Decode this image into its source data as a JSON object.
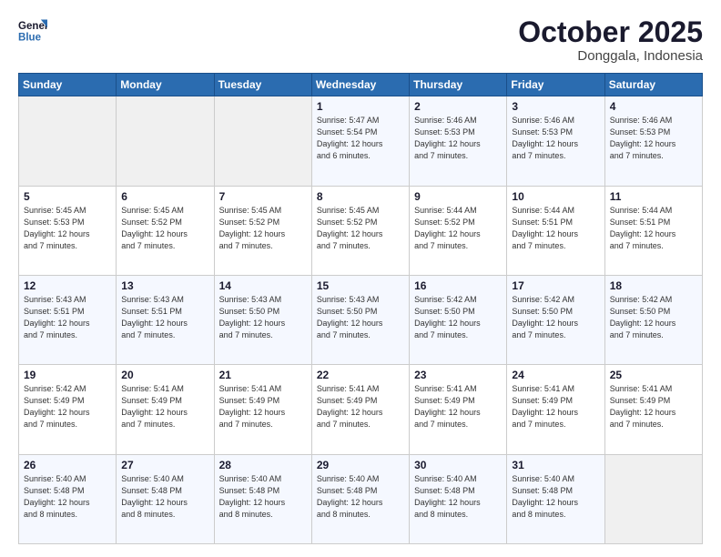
{
  "header": {
    "logo_line1": "General",
    "logo_line2": "Blue",
    "month": "October 2025",
    "location": "Donggala, Indonesia"
  },
  "weekdays": [
    "Sunday",
    "Monday",
    "Tuesday",
    "Wednesday",
    "Thursday",
    "Friday",
    "Saturday"
  ],
  "weeks": [
    [
      {
        "day": "",
        "info": ""
      },
      {
        "day": "",
        "info": ""
      },
      {
        "day": "",
        "info": ""
      },
      {
        "day": "1",
        "info": "Sunrise: 5:47 AM\nSunset: 5:54 PM\nDaylight: 12 hours\nand 6 minutes."
      },
      {
        "day": "2",
        "info": "Sunrise: 5:46 AM\nSunset: 5:53 PM\nDaylight: 12 hours\nand 7 minutes."
      },
      {
        "day": "3",
        "info": "Sunrise: 5:46 AM\nSunset: 5:53 PM\nDaylight: 12 hours\nand 7 minutes."
      },
      {
        "day": "4",
        "info": "Sunrise: 5:46 AM\nSunset: 5:53 PM\nDaylight: 12 hours\nand 7 minutes."
      }
    ],
    [
      {
        "day": "5",
        "info": "Sunrise: 5:45 AM\nSunset: 5:53 PM\nDaylight: 12 hours\nand 7 minutes."
      },
      {
        "day": "6",
        "info": "Sunrise: 5:45 AM\nSunset: 5:52 PM\nDaylight: 12 hours\nand 7 minutes."
      },
      {
        "day": "7",
        "info": "Sunrise: 5:45 AM\nSunset: 5:52 PM\nDaylight: 12 hours\nand 7 minutes."
      },
      {
        "day": "8",
        "info": "Sunrise: 5:45 AM\nSunset: 5:52 PM\nDaylight: 12 hours\nand 7 minutes."
      },
      {
        "day": "9",
        "info": "Sunrise: 5:44 AM\nSunset: 5:52 PM\nDaylight: 12 hours\nand 7 minutes."
      },
      {
        "day": "10",
        "info": "Sunrise: 5:44 AM\nSunset: 5:51 PM\nDaylight: 12 hours\nand 7 minutes."
      },
      {
        "day": "11",
        "info": "Sunrise: 5:44 AM\nSunset: 5:51 PM\nDaylight: 12 hours\nand 7 minutes."
      }
    ],
    [
      {
        "day": "12",
        "info": "Sunrise: 5:43 AM\nSunset: 5:51 PM\nDaylight: 12 hours\nand 7 minutes."
      },
      {
        "day": "13",
        "info": "Sunrise: 5:43 AM\nSunset: 5:51 PM\nDaylight: 12 hours\nand 7 minutes."
      },
      {
        "day": "14",
        "info": "Sunrise: 5:43 AM\nSunset: 5:50 PM\nDaylight: 12 hours\nand 7 minutes."
      },
      {
        "day": "15",
        "info": "Sunrise: 5:43 AM\nSunset: 5:50 PM\nDaylight: 12 hours\nand 7 minutes."
      },
      {
        "day": "16",
        "info": "Sunrise: 5:42 AM\nSunset: 5:50 PM\nDaylight: 12 hours\nand 7 minutes."
      },
      {
        "day": "17",
        "info": "Sunrise: 5:42 AM\nSunset: 5:50 PM\nDaylight: 12 hours\nand 7 minutes."
      },
      {
        "day": "18",
        "info": "Sunrise: 5:42 AM\nSunset: 5:50 PM\nDaylight: 12 hours\nand 7 minutes."
      }
    ],
    [
      {
        "day": "19",
        "info": "Sunrise: 5:42 AM\nSunset: 5:49 PM\nDaylight: 12 hours\nand 7 minutes."
      },
      {
        "day": "20",
        "info": "Sunrise: 5:41 AM\nSunset: 5:49 PM\nDaylight: 12 hours\nand 7 minutes."
      },
      {
        "day": "21",
        "info": "Sunrise: 5:41 AM\nSunset: 5:49 PM\nDaylight: 12 hours\nand 7 minutes."
      },
      {
        "day": "22",
        "info": "Sunrise: 5:41 AM\nSunset: 5:49 PM\nDaylight: 12 hours\nand 7 minutes."
      },
      {
        "day": "23",
        "info": "Sunrise: 5:41 AM\nSunset: 5:49 PM\nDaylight: 12 hours\nand 7 minutes."
      },
      {
        "day": "24",
        "info": "Sunrise: 5:41 AM\nSunset: 5:49 PM\nDaylight: 12 hours\nand 7 minutes."
      },
      {
        "day": "25",
        "info": "Sunrise: 5:41 AM\nSunset: 5:49 PM\nDaylight: 12 hours\nand 7 minutes."
      }
    ],
    [
      {
        "day": "26",
        "info": "Sunrise: 5:40 AM\nSunset: 5:48 PM\nDaylight: 12 hours\nand 8 minutes."
      },
      {
        "day": "27",
        "info": "Sunrise: 5:40 AM\nSunset: 5:48 PM\nDaylight: 12 hours\nand 8 minutes."
      },
      {
        "day": "28",
        "info": "Sunrise: 5:40 AM\nSunset: 5:48 PM\nDaylight: 12 hours\nand 8 minutes."
      },
      {
        "day": "29",
        "info": "Sunrise: 5:40 AM\nSunset: 5:48 PM\nDaylight: 12 hours\nand 8 minutes."
      },
      {
        "day": "30",
        "info": "Sunrise: 5:40 AM\nSunset: 5:48 PM\nDaylight: 12 hours\nand 8 minutes."
      },
      {
        "day": "31",
        "info": "Sunrise: 5:40 AM\nSunset: 5:48 PM\nDaylight: 12 hours\nand 8 minutes."
      },
      {
        "day": "",
        "info": ""
      }
    ]
  ]
}
